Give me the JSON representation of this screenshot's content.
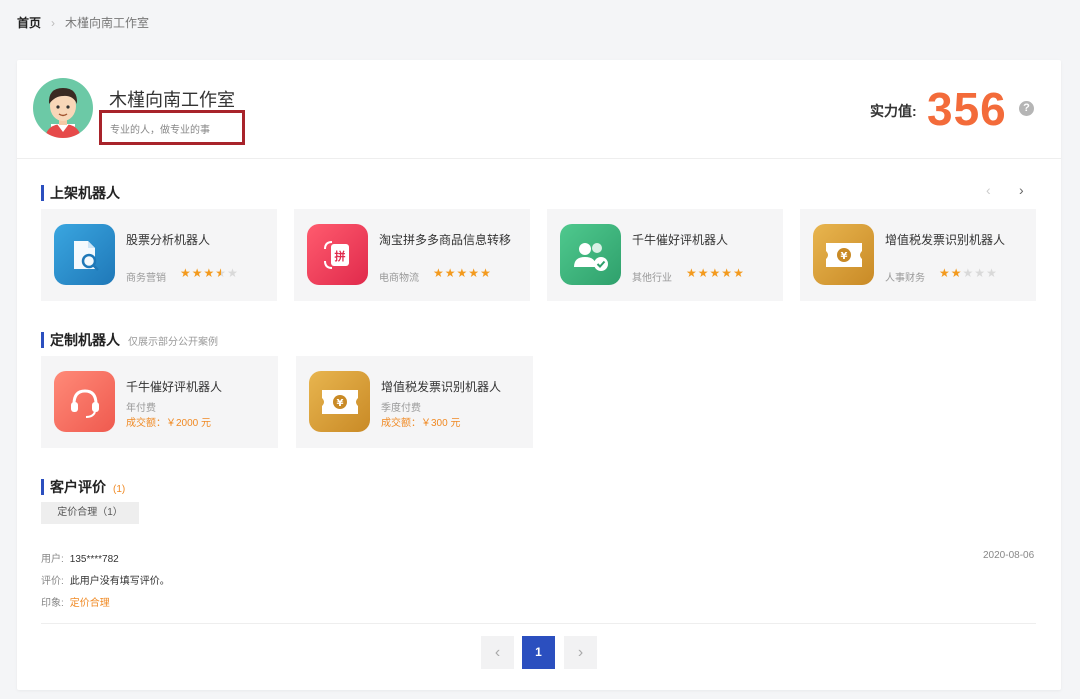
{
  "breadcrumb": {
    "home": "首页",
    "separator": "›",
    "current": "木槿向南工作室"
  },
  "profile": {
    "name": "木槿向南工作室",
    "slogan": "专业的人，做专业的事",
    "power_label": "实力值:",
    "power_value": "356",
    "help_icon": "?"
  },
  "listed": {
    "title": "上架机器人",
    "prev_icon": "‹",
    "next_icon": "›",
    "items": [
      {
        "name": "股票分析机器人",
        "category": "商务营销",
        "rating": 3.5,
        "icon": "document-search-icon",
        "color": "#2d8fd0"
      },
      {
        "name": "淘宝拼多多商品信息转移",
        "category": "电商物流",
        "rating": 5,
        "icon": "transfer-icon",
        "color": "#f0415f"
      },
      {
        "name": "千牛催好评机器人",
        "category": "其他行业",
        "rating": 5,
        "icon": "users-check-icon",
        "color": "#3fb27f"
      },
      {
        "name": "增值税发票识别机器人",
        "category": "人事财务",
        "rating": 2,
        "icon": "invoice-yen-icon",
        "color": "#dba33f"
      }
    ]
  },
  "custom": {
    "title": "定制机器人",
    "hint": "仅展示部分公开案例",
    "items": [
      {
        "name": "千牛催好评机器人",
        "billing": "年付费",
        "deal": "成交额：￥2000 元",
        "icon": "headset-icon",
        "color": "#f67a6c"
      },
      {
        "name": "增值税发票识别机器人",
        "billing": "季度付费",
        "deal": "成交额：￥300 元",
        "icon": "invoice-yen-icon",
        "color": "#dba33f"
      }
    ]
  },
  "reviews": {
    "title": "客户评价",
    "count": "(1)",
    "tag": "定价合理（1）",
    "entry": {
      "user_label": "用户:",
      "user": "135****782",
      "comment_label": "评价:",
      "comment": "此用户没有填写评价。",
      "impression_label": "印象:",
      "impression": "定价合理",
      "date": "2020-08-06"
    }
  },
  "pagination": {
    "prev": "‹",
    "current": "1",
    "next": "›"
  }
}
